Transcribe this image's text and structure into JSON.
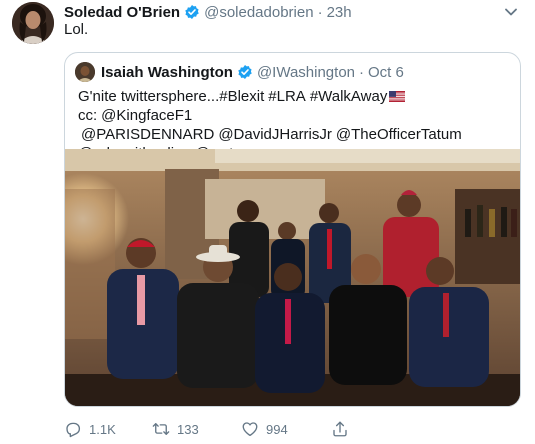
{
  "tweet": {
    "author_name": "Soledad O'Brien",
    "author_handle": "@soledadobrien",
    "separator": "·",
    "time": "23h",
    "text": "Lol.",
    "verified_icon": "verified-badge-icon",
    "caret_icon": "chevron-down-icon"
  },
  "quoted": {
    "author_name": "Isaiah Washington",
    "author_handle": "@IWashington",
    "separator": "·",
    "time": "Oct 6",
    "text_parts": [
      "G'nite twittersphere...#Blexit",
      "#LRA",
      "#WalkAway",
      "cc:",
      "@KingfaceF1",
      "@PARISDENNARD",
      "@DavidJHarrisJr",
      "@TheOfficerTatum",
      "@robsmithonline",
      "@w_terrence"
    ],
    "flag_icon": "us-flag-icon"
  },
  "actions": {
    "reply_count": "1.1K",
    "retweet_count": "133",
    "like_count": "994",
    "share_label": ""
  },
  "colors": {
    "verified_blue": "#1da1f2",
    "text_primary": "#14171a",
    "text_secondary": "#657786",
    "border": "#ccd6dd"
  }
}
